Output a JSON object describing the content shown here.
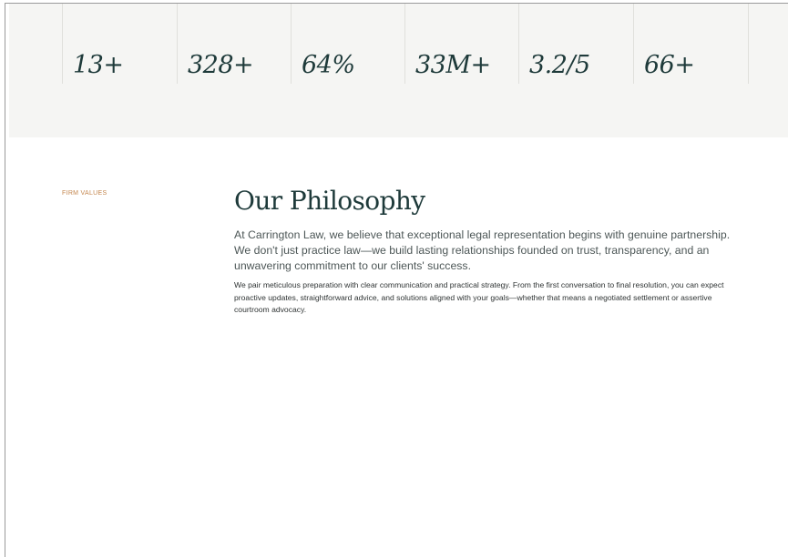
{
  "stats": [
    {
      "value": "13+"
    },
    {
      "value": "328+"
    },
    {
      "value": "64%"
    },
    {
      "value": "33M+"
    },
    {
      "value": "3.2/5"
    },
    {
      "value": "66+"
    }
  ],
  "philosophy": {
    "eyebrow": "FIRM VALUES",
    "title": "Our Philosophy",
    "lead": "At Carrington Law, we believe that exceptional legal representation begins with genuine partnership. We don't just practice law—we build lasting relationships founded on trust, transparency, and an unwavering commitment to our clients' success.",
    "body": "We pair meticulous preparation with clear communication and practical strategy. From the first conversation to final resolution, you can expect proactive updates, straightforward advice, and solutions aligned with your goals—whether that means a negotiated settlement or assertive courtroom advocacy."
  },
  "colors": {
    "band_background": "#f5f5f3",
    "heading": "#1e3a3a",
    "accent": "#c4874f",
    "text": "#4d5757"
  }
}
